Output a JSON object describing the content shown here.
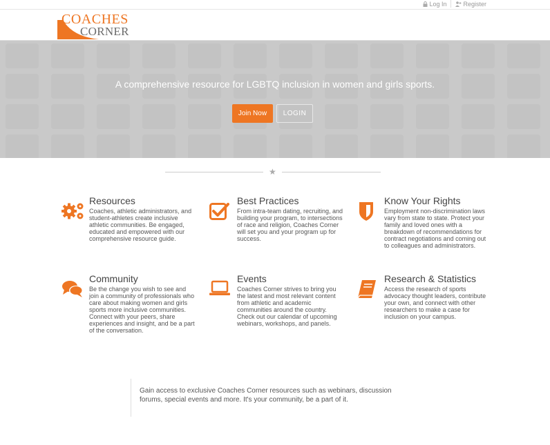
{
  "topbar": {
    "login": "Log In",
    "register": "Register"
  },
  "logo": {
    "line1": "COACHES",
    "line2": "CORNER"
  },
  "hero": {
    "tagline": "A  comprehensive resource for LGBTQ inclusion in women and girls sports.",
    "join_label": "Join Now",
    "login_label": "LOGIN"
  },
  "features": [
    {
      "title": "Resources",
      "icon": "gears-icon",
      "text": "Coaches, athletic administrators, and student-athletes create inclusive athletic communities.  Be engaged, educated and empowered with our comprehensive resource guide."
    },
    {
      "title": "Best Practices",
      "icon": "checkbox-icon",
      "text": "From intra-team dating, recruiting, and building your program, to intersections of race and religion, Coaches Corner will set you and your program up for success."
    },
    {
      "title": "Know Your Rights",
      "icon": "shield-icon",
      "text": "Employment non-discrimination laws vary from state to state. Protect your family and loved ones with a breakdown of recommendations for contract negotiations and coming out to colleagues and administrators."
    },
    {
      "title": "Community",
      "icon": "chat-bubbles-icon",
      "text": "Be the change you wish to see and join a community of professionals who care about making women and girls sports more inclusive communities. Connect with your peers, share experiences and insight, and be a part of the conversation."
    },
    {
      "title": "Events",
      "icon": "laptop-icon",
      "text": "Coaches Corner strives to bring you the latest and most relevant content from athletic and academic communities around the country. Check out our calendar of upcoming webinars, workshops, and panels."
    },
    {
      "title": "Research & Statistics",
      "icon": "book-icon",
      "text": "Access the research of sports advocacy thought leaders, contribute your own, and connect with other researchers to make a case for inclusion on your campus."
    }
  ],
  "cta": {
    "text": "Gain access to exclusive Coaches Corner resources such as webinars, discussion forums, special events and more. It's your community, be a part of it."
  },
  "colors": {
    "accent": "#ee7623",
    "hero_bg": "#c9c9c9",
    "text": "#444444"
  }
}
